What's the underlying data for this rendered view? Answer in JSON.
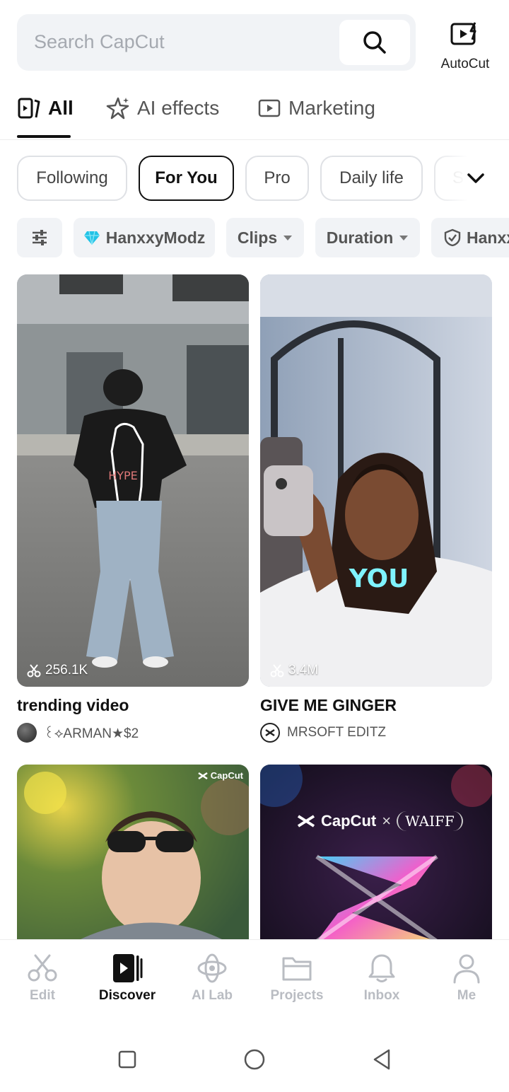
{
  "search": {
    "placeholder": "Search CapCut",
    "autocut_label": "AutoCut"
  },
  "top_tabs": [
    {
      "label": "All",
      "icon": "template-icon",
      "active": true
    },
    {
      "label": "AI effects",
      "icon": "sparkle-star-icon",
      "active": false
    },
    {
      "label": "Marketing",
      "icon": "play-box-icon",
      "active": false
    }
  ],
  "chips": [
    {
      "label": "Following",
      "active": false
    },
    {
      "label": "For You",
      "active": true
    },
    {
      "label": "Pro",
      "active": false
    },
    {
      "label": "Daily life",
      "active": false
    },
    {
      "label": "S",
      "active": false
    }
  ],
  "filters": [
    {
      "label": "",
      "icon": "sliders-icon"
    },
    {
      "label": "HanxxyModz",
      "icon": "diamond-icon"
    },
    {
      "label": "Clips",
      "icon": "caret-down-icon"
    },
    {
      "label": "Duration",
      "icon": "caret-down-icon"
    },
    {
      "label": "Hanxx",
      "icon": "shield-icon"
    }
  ],
  "cards": [
    {
      "title": "trending video",
      "author": "꒰⟡ARMAN★$2",
      "uses": "256.1K"
    },
    {
      "title": "GIVE ME GINGER",
      "author": "MRSOFT EDITZ",
      "uses": "3.4M",
      "overlay_text": "YOU"
    },
    {
      "watermark": "CapCut"
    },
    {
      "brand": "CapCut",
      "cross": "×",
      "partner": "WAIFF"
    }
  ],
  "bottom_nav": [
    {
      "label": "Edit",
      "icon": "scissors-icon",
      "active": false
    },
    {
      "label": "Discover",
      "icon": "discover-icon",
      "active": true
    },
    {
      "label": "AI Lab",
      "icon": "ai-lab-icon",
      "active": false
    },
    {
      "label": "Projects",
      "icon": "folder-icon",
      "active": false
    },
    {
      "label": "Inbox",
      "icon": "bell-icon",
      "active": false
    },
    {
      "label": "Me",
      "icon": "person-icon",
      "active": false
    }
  ],
  "colors": {
    "accent": "#111111",
    "chip_border": "#dfe1e5",
    "muted": "#b9bcc2",
    "diamond": "#22c3e6"
  }
}
